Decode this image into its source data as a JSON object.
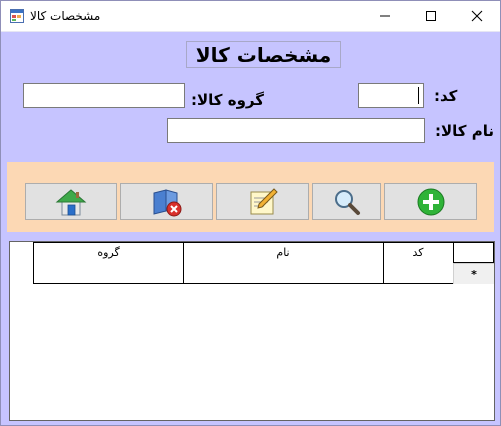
{
  "window": {
    "title": "مشخصات کالا",
    "minimize_symbol": "—",
    "maximize_symbol": "☐",
    "close_symbol": "✕"
  },
  "form": {
    "heading": "مشخصات کالا",
    "code_label": "کد:",
    "code_value": "",
    "group_label": "گروه کالا:",
    "group_value": "",
    "name_label": "نام کالا:",
    "name_value": ""
  },
  "toolbar": {
    "buttons": [
      {
        "name": "home",
        "icon": "home-icon"
      },
      {
        "name": "delete",
        "icon": "book-delete-icon"
      },
      {
        "name": "edit",
        "icon": "edit-note-icon"
      },
      {
        "name": "search",
        "icon": "magnifier-icon"
      },
      {
        "name": "add",
        "icon": "add-green-icon"
      }
    ]
  },
  "grid": {
    "columns": [
      "کد",
      "نام",
      "گروه"
    ],
    "new_row_marker": "*"
  },
  "colors": {
    "window_bg": "#c6c4ff",
    "toolbar_bg": "#fcd8b4",
    "add_green": "#2fb338"
  }
}
